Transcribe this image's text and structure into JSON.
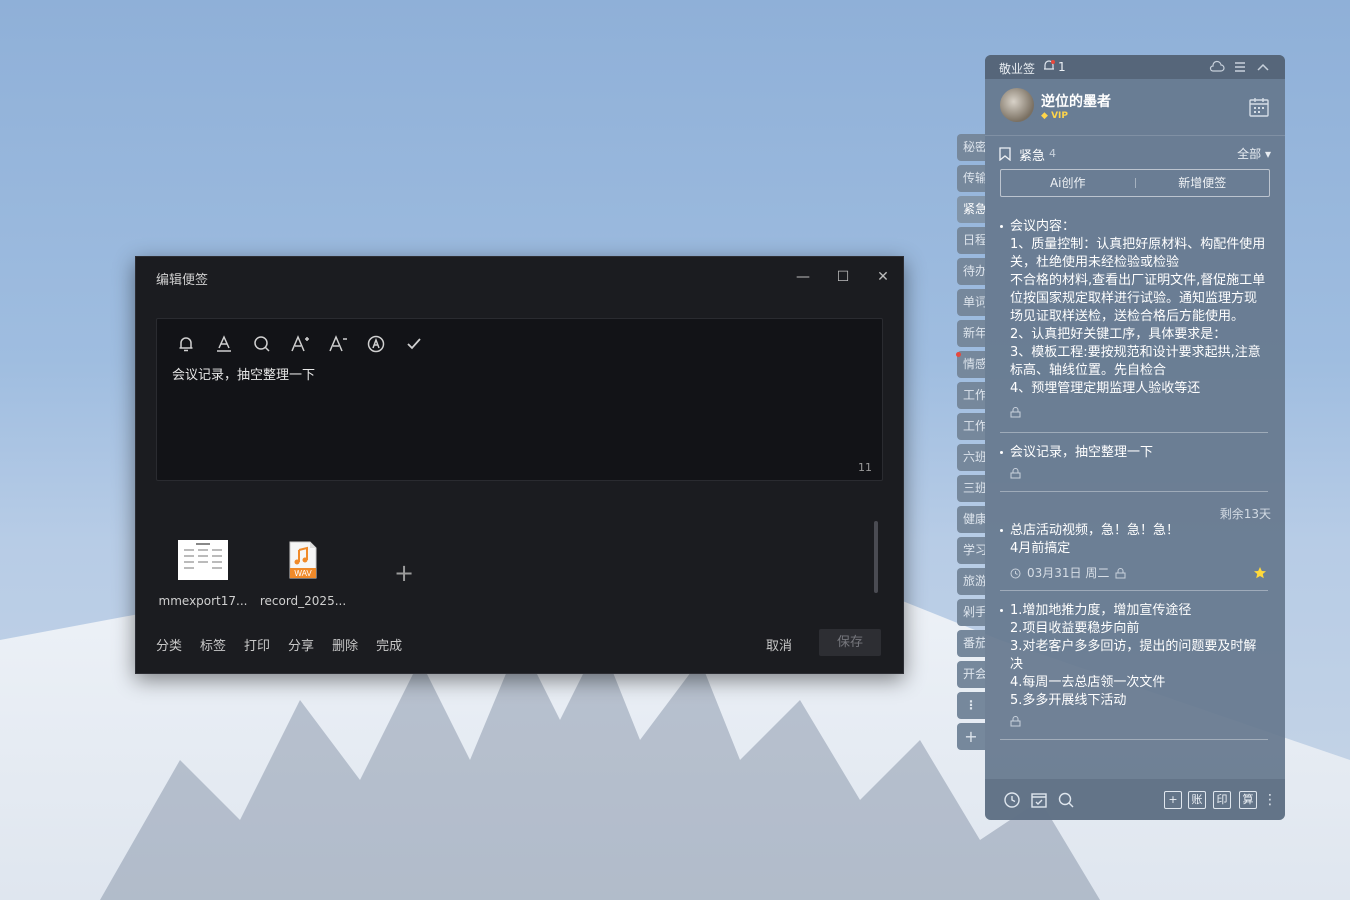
{
  "editor": {
    "title": "编辑便签",
    "content": "会议记录，抽空整理一下",
    "char_count": "11",
    "attachments": [
      {
        "name": "mmexport17..."
      },
      {
        "name": "record_2025..."
      }
    ],
    "actions": [
      "分类",
      "标签",
      "打印",
      "分享",
      "删除",
      "完成"
    ],
    "cancel": "取消",
    "save": "保存"
  },
  "side_tabs": [
    "秘密",
    "传输",
    "紧急",
    "日程",
    "待办",
    "单词",
    "新年",
    "情感",
    "工作",
    "工作",
    "六班",
    "三班",
    "健康",
    "学习",
    "旅游",
    "剁手",
    "番茄",
    "开会"
  ],
  "panel": {
    "app_name": "敬业签",
    "bell_count": "1",
    "user": {
      "name": "逆位的墨者",
      "badge": "VIP"
    },
    "category": {
      "name": "紧急",
      "count": "4",
      "filter": "全部"
    },
    "buttons": {
      "ai": "Ai创作",
      "new": "新增便签"
    },
    "notes": [
      {
        "lines": [
          "会议内容：",
          "1、质量控制：认真把好原材料、构配件使用关，杜绝使用未经检验或检验",
          "不合格的材料,查看出厂证明文件,督促施工单位按国家规定取样进行试验。通知监理方现场见证取样送检，送检合格后方能使用。",
          "2、认真把好关键工序，具体要求是：",
          "3、模板工程:要按规范和设计要求起拱,注意标高、轴线位置。先自检合",
          "4、预埋管理定期监理人验收等还"
        ]
      },
      {
        "lines": [
          "会议记录，抽空整理一下"
        ]
      },
      {
        "remain": "剩余13天",
        "lines": [
          "总店活动视频，急！急！急！",
          "4月前搞定"
        ],
        "date": "03月31日 周二"
      },
      {
        "lines": [
          "1.增加地推力度，增加宣传途径",
          "2.项目收益要稳步向前",
          "3.对老客户多多回访，提出的问题要及时解决",
          "4.每周一去总店领一次文件",
          "5.多多开展线下活动"
        ]
      }
    ],
    "bottom_buttons": [
      "账",
      "印",
      "算"
    ]
  },
  "colors": {
    "panel_bg": "#66788e",
    "editor_bg": "#1b1c20",
    "star": "#ffd93b",
    "vip": "#ffd54a"
  }
}
